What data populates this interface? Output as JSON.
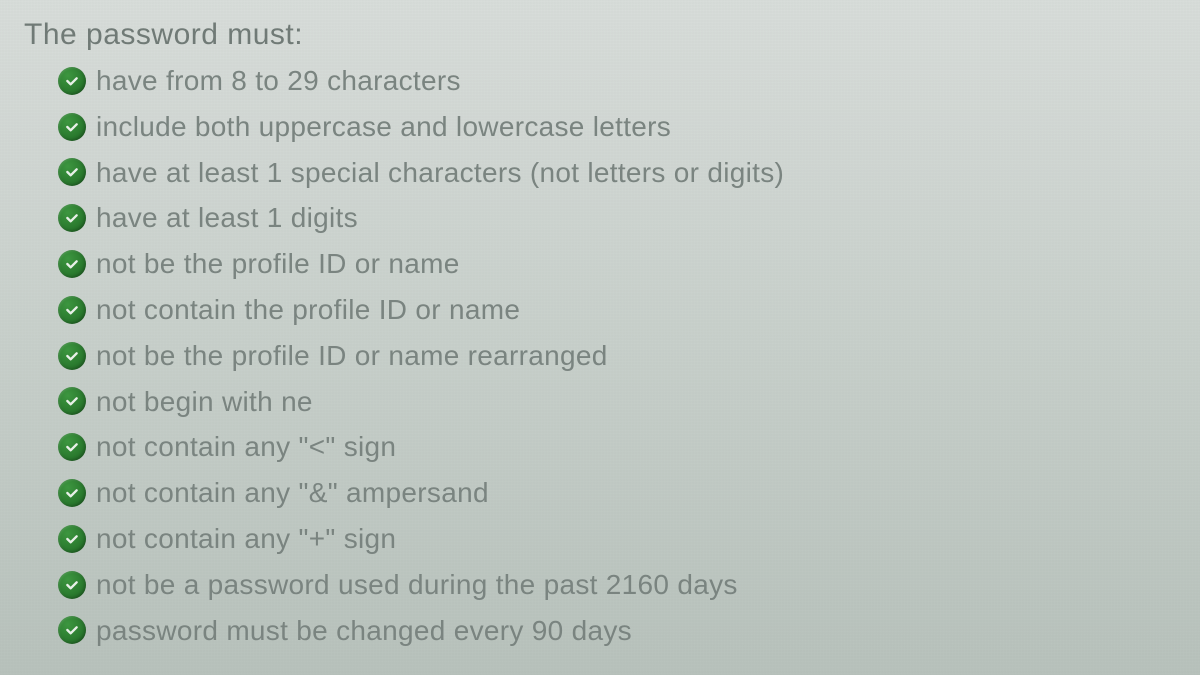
{
  "heading": "The password must:",
  "rules": [
    {
      "text": "have from 8 to 29 characters"
    },
    {
      "text": "include both uppercase and lowercase letters"
    },
    {
      "text": "have at least 1 special characters (not letters or digits)"
    },
    {
      "text": "have at least 1 digits"
    },
    {
      "text": "not be the profile ID or name"
    },
    {
      "text": "not contain the profile ID or name"
    },
    {
      "text": "not be the profile ID or name rearranged"
    },
    {
      "text": "not begin with ne"
    },
    {
      "text": "not contain any \"<\" sign"
    },
    {
      "text": "not contain any \"&\" ampersand"
    },
    {
      "text": "not contain any \"+\" sign"
    },
    {
      "text": "not be a password used during the past 2160 days"
    },
    {
      "text": "password must be changed every 90 days"
    }
  ],
  "icon": {
    "name": "check-circle-icon",
    "color": "#2a7a2e"
  }
}
